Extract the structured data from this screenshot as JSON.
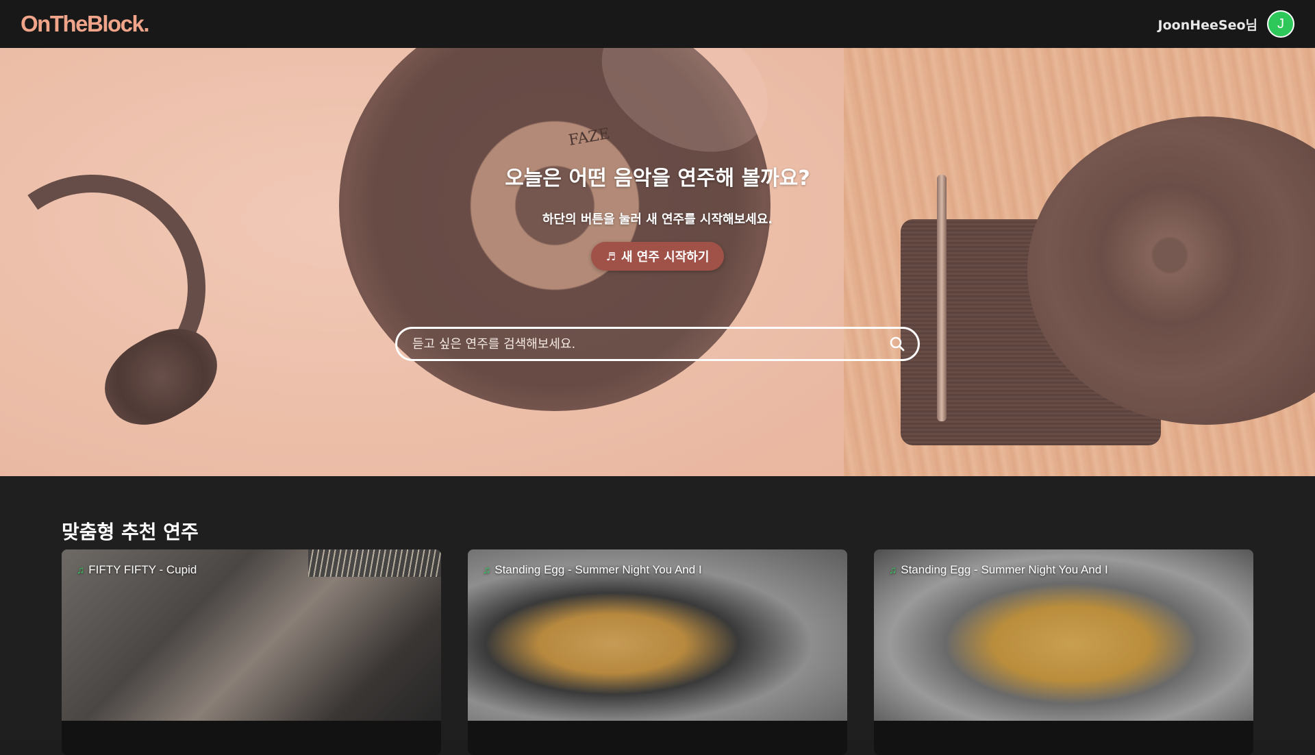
{
  "header": {
    "logo": "OnTheBlock.",
    "user_name": "JoonHeeSeo님",
    "avatar_initial": "J",
    "avatar_color": "#2ec85a"
  },
  "hero": {
    "title": "오늘은 어떤 음악을 연주해 볼까요?",
    "subtitle": "하단의 버튼을 눌러 새 연주를 시작해보세요.",
    "start_button": "새 연주 시작하기",
    "record_label": "FAZE",
    "search_placeholder": "듣고 싶은 연주를 검색해보세요.",
    "button_color": "#a05249"
  },
  "recommendations": {
    "title": "맞춤형 추천 연주",
    "cards": [
      {
        "tag": "FIFTY FIFTY - Cupid"
      },
      {
        "tag": "Standing Egg - Summer Night You And I"
      },
      {
        "tag": "Standing Egg - Summer Night You And I"
      }
    ]
  },
  "icons": {
    "note": "music-note-icon",
    "search": "search-icon"
  },
  "colors": {
    "brand": "#f0a58a",
    "header_bg": "#181818",
    "page_bg": "#1f1f1f"
  }
}
